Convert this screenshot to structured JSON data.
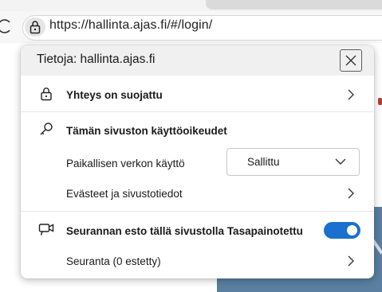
{
  "browser": {
    "url": "https://hallinta.ajas.fi/#/login/"
  },
  "popup": {
    "title": "Tietoja: hallinta.ajas.fi",
    "connection": {
      "label": "Yhteys on suojattu"
    },
    "permissions": {
      "heading": "Tämän sivuston käyttöoikeudet",
      "local_network_label": "Paikallisen verkon käyttö",
      "local_network_value": "Sallittu",
      "cookies_label": "Evästeet ja sivustotiedot"
    },
    "tracking": {
      "label": "Seurannan esto tällä sivustolla Tasapainotettu",
      "enabled": true,
      "trackers_label": "Seuranta (0 estetty)"
    }
  },
  "colors": {
    "accent": "#1a6fcf",
    "header_bg": "#f0f0f0"
  },
  "icons": [
    "reload-icon",
    "lock-icon",
    "close-icon",
    "key-icon",
    "camera-tracking-icon",
    "chevron-right-icon",
    "chevron-down-icon"
  ]
}
